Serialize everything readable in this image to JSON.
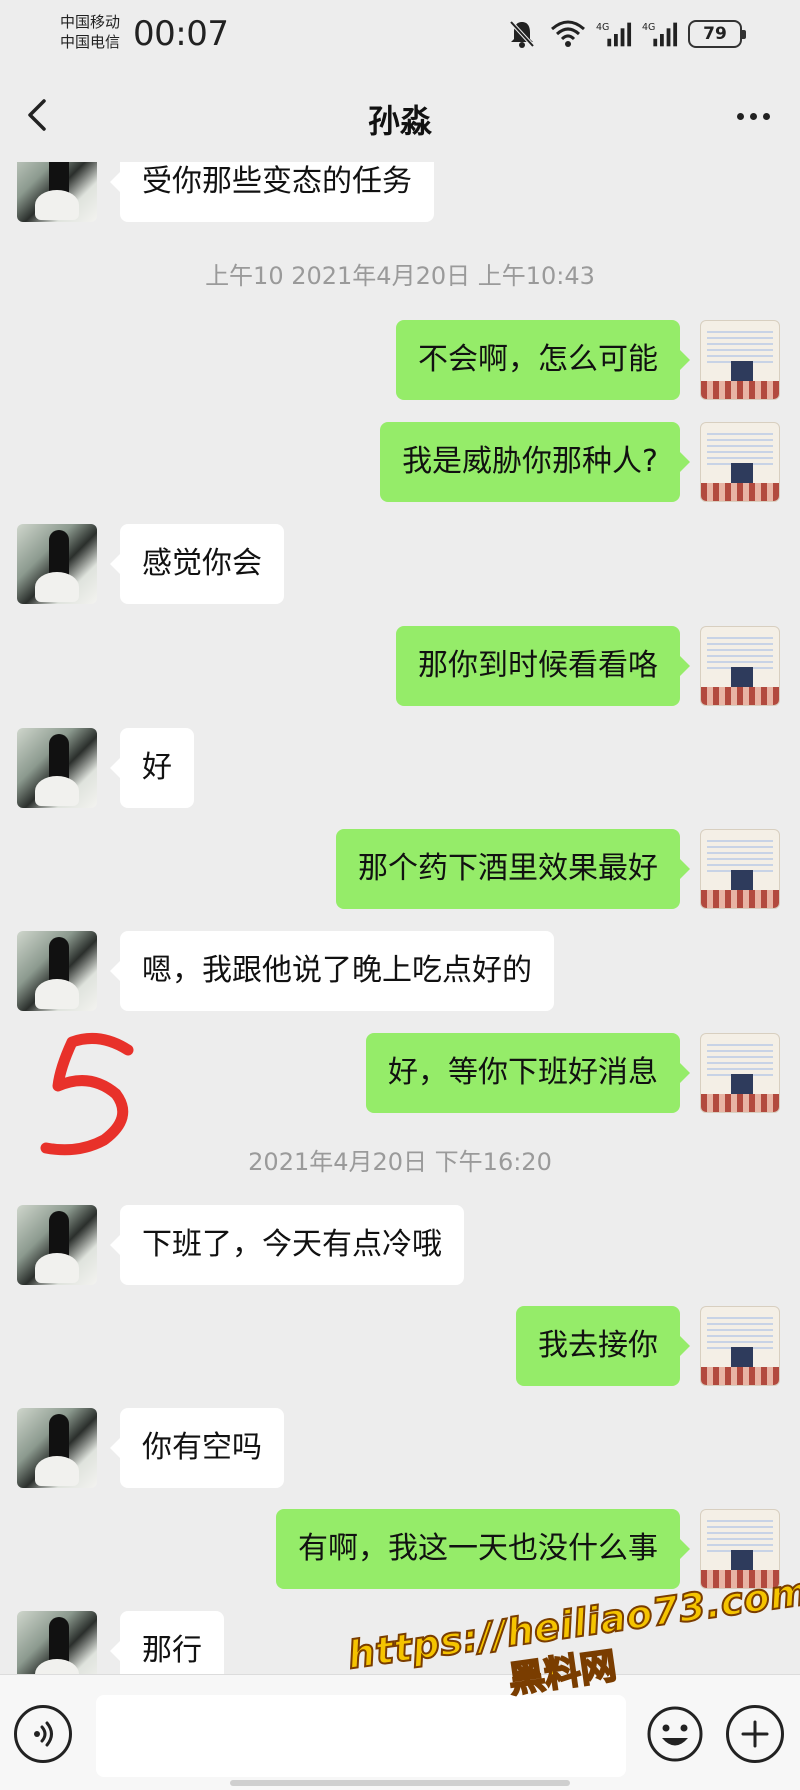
{
  "status_bar": {
    "carrier_1": "中国移动",
    "carrier_2": "中国电信",
    "time": "00:07",
    "network_1": "4G",
    "network_2": "4G",
    "battery": "79"
  },
  "header": {
    "title": "孙淼"
  },
  "timestamps": {
    "t1": "上午10 2021年4月20日 上午10:43",
    "t2": "2021年4月20日 下午16:20"
  },
  "messages": [
    {
      "side": "left",
      "text": "受你那些变态的任务"
    },
    {
      "side": "right",
      "text": "不会啊，怎么可能"
    },
    {
      "side": "right",
      "text": "我是威胁你那种人?"
    },
    {
      "side": "left",
      "text": "感觉你会"
    },
    {
      "side": "right",
      "text": "那你到时候看看咯"
    },
    {
      "side": "left",
      "text": "好"
    },
    {
      "side": "right",
      "text": "那个药下酒里效果最好"
    },
    {
      "side": "left",
      "text": "嗯，我跟他说了晚上吃点好的"
    },
    {
      "side": "right",
      "text": "好，等你下班好消息"
    },
    {
      "side": "left",
      "text": "下班了，今天有点冷哦"
    },
    {
      "side": "right",
      "text": "我去接你"
    },
    {
      "side": "left",
      "text": "你有空吗"
    },
    {
      "side": "right",
      "text": "有啊，我这一天也没什么事"
    },
    {
      "side": "left",
      "text": "那行"
    }
  ],
  "annotation": "5",
  "watermark": {
    "url": "https://heiliao73.com",
    "name": "黑料网"
  },
  "colors": {
    "background": "#ededed",
    "outgoing_bubble": "#95ec69",
    "incoming_bubble": "#ffffff",
    "timestamp_text": "#9a9a9a",
    "watermark": "#f5c400"
  }
}
